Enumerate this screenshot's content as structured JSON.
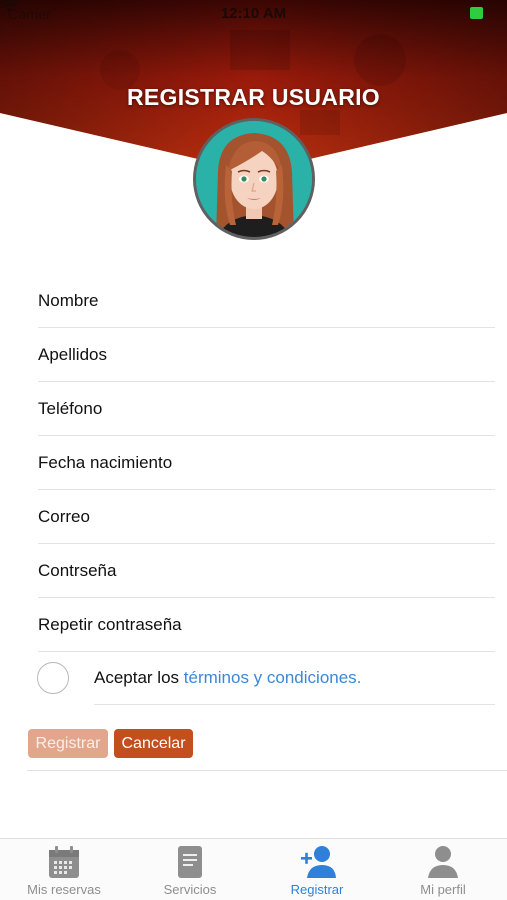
{
  "status_bar": {
    "carrier": "Carrier",
    "time": "12:10 AM"
  },
  "header": {
    "title": "REGISTRAR USUARIO"
  },
  "form": {
    "fields": [
      {
        "label": "Nombre"
      },
      {
        "label": "Apellidos"
      },
      {
        "label": "Teléfono"
      },
      {
        "label": "Fecha nacimiento"
      },
      {
        "label": "Correo"
      },
      {
        "label": "Contrseña"
      },
      {
        "label": "Repetir contraseña"
      }
    ],
    "terms": {
      "prefix": "Aceptar los ",
      "link": "términos y condiciones.",
      "checked": false
    },
    "buttons": {
      "register": "Registrar",
      "cancel": "Cancelar"
    }
  },
  "tabbar": {
    "tabs": [
      {
        "label": "Mis reservas",
        "icon": "calendar-icon"
      },
      {
        "label": "Servicios",
        "icon": "document-icon"
      },
      {
        "label": "Registrar",
        "icon": "add-user-icon",
        "active": true
      },
      {
        "label": "Mi perfil",
        "icon": "person-icon"
      }
    ]
  },
  "colors": {
    "accent": "#2f80d9",
    "brand": "#c34e1e",
    "header": "#a8200d",
    "link": "#3b88d8"
  }
}
